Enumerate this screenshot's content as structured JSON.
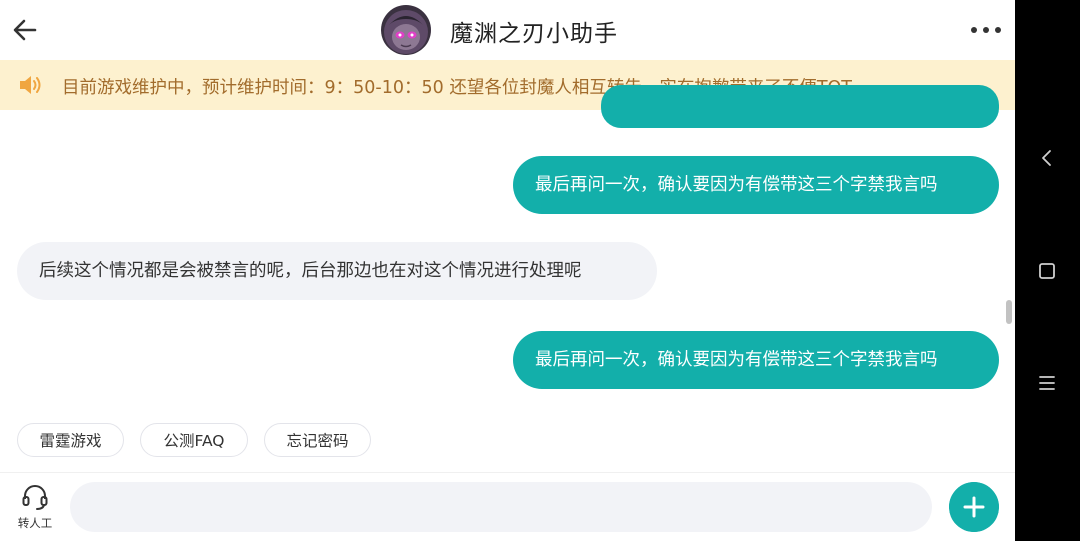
{
  "header": {
    "title": "魔渊之刃小助手"
  },
  "notice": {
    "text": "目前游戏维护中，预计维护时间：9：50-10：50 还望各位封魔人相互转告，实在抱歉带来了不便TOT"
  },
  "messages": [
    {
      "side": "out",
      "text": "最后再问一次，确认要因为有偿带这三个字禁我言吗"
    },
    {
      "side": "in",
      "text": "后续这个情况都是会被禁言的呢，后台那边也在对这个情况进行处理呢"
    },
    {
      "side": "out",
      "text": "最后再问一次，确认要因为有偿带这三个字禁我言吗"
    }
  ],
  "quick_replies": [
    "雷霆游戏",
    "公测FAQ",
    "忘记密码"
  ],
  "bottom": {
    "agent_label": "转人工",
    "input_placeholder": ""
  },
  "colors": {
    "accent": "#13afaa",
    "notice_bg": "#fdf1cf",
    "notice_text": "#a26c2c",
    "incoming_bubble": "#f2f3f7"
  },
  "icons": {
    "back": "arrow-left-icon",
    "more": "more-dots-icon",
    "notice": "speaker-icon",
    "agent": "headset-icon",
    "send_more": "plus-icon",
    "sys_back": "chevron-left-icon",
    "sys_home": "square-icon",
    "sys_menu": "menu-lines-icon"
  }
}
